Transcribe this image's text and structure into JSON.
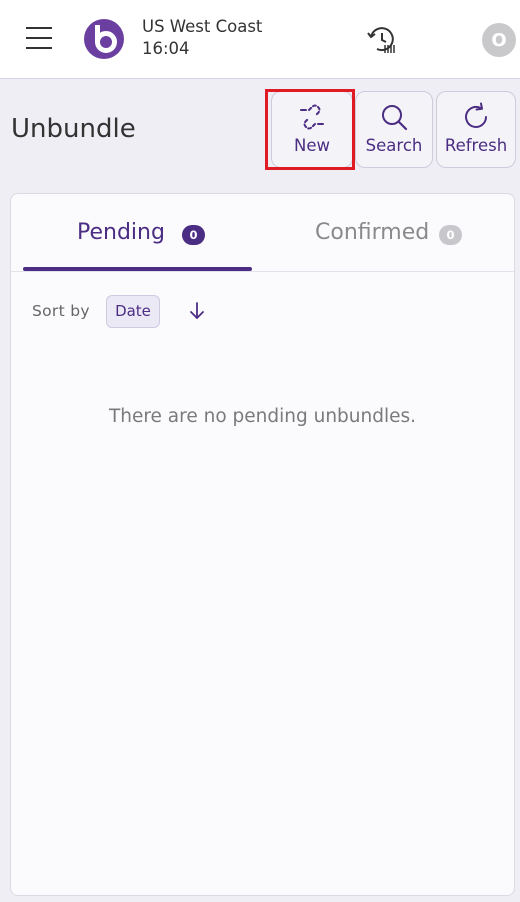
{
  "header": {
    "menu_icon": "hamburger-menu-icon",
    "logo_icon": "brand-logo-icon",
    "location": "US West Coast",
    "time": "16:04",
    "history_icon": "clock-history-icon",
    "avatar_initial": "O"
  },
  "page": {
    "title": "Unbundle"
  },
  "toolbar": {
    "new_label": "New",
    "new_icon": "unlink-icon",
    "search_label": "Search",
    "search_icon": "search-icon",
    "refresh_label": "Refresh",
    "refresh_icon": "refresh-icon"
  },
  "tabs": [
    {
      "label": "Pending",
      "count": "0",
      "active": true
    },
    {
      "label": "Confirmed",
      "count": "0",
      "active": false
    }
  ],
  "sort": {
    "label": "Sort by",
    "field": "Date",
    "direction_icon": "arrow-down-icon"
  },
  "empty_message": "There are no pending unbundles.",
  "colors": {
    "accent": "#4b2d83",
    "background": "#efeef4",
    "highlight": "#e01b24",
    "inactive_badge": "#c8c8cc"
  }
}
